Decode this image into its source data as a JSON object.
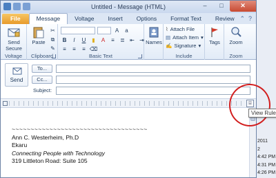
{
  "window": {
    "title": "Untitled - Message (HTML)"
  },
  "tabs": [
    "File",
    "Message",
    "Voltage",
    "Insert",
    "Options",
    "Format Text",
    "Review"
  ],
  "ribbon": {
    "voltage": {
      "send_secure": "Send Secure",
      "label": "Voltage"
    },
    "clipboard": {
      "paste": "Paste",
      "label": "Clipboard"
    },
    "basic_text": {
      "label": "Basic Text"
    },
    "names": {
      "label": "Names"
    },
    "include": {
      "attach_file": "Attach File",
      "attach_item": "Attach Item",
      "signature": "Signature",
      "label": "Include"
    },
    "tags": {
      "label": "Tags"
    },
    "zoom": {
      "zoom": "Zoom",
      "label": "Zoom"
    }
  },
  "fields": {
    "send": "Send",
    "to": "To...",
    "cc": "Cc...",
    "subject": "Subject:"
  },
  "signature": {
    "wavy": "~~~~~~~~~~~~~~~~~~~~~~~~~~~~~~~~~~~~",
    "name": "Ann C. Westerheim, Ph.D",
    "company": "Ekaru",
    "tagline": "Connecting People with Technology",
    "address": "319 Littleton Road: Suite 105"
  },
  "tooltip": "View Ruler",
  "background_list": [
    "2011",
    "2",
    "4:42 PM",
    "4:31 PM",
    "4:26 PM"
  ],
  "colors": {
    "file_tab": "#e89b2c",
    "highlight_circle": "#d21e1e",
    "title_bar": "#dfe8f5"
  }
}
